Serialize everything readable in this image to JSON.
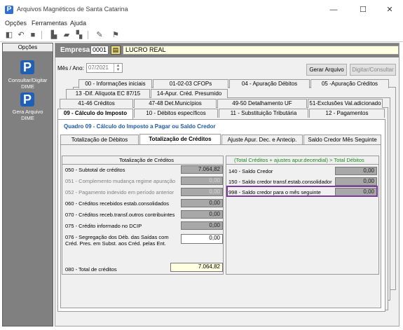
{
  "window": {
    "title": "Arquivos Magnéticos de Santa Catarina",
    "minimize": "—",
    "maximize": "☐",
    "close": "✕"
  },
  "menu": [
    "Opções",
    "Ferramentas",
    "Ajuda"
  ],
  "sidebar": {
    "header": "Opções",
    "items": [
      {
        "label_l1": "Consultar/Digitar",
        "label_l2": "DIME",
        "icon": "P"
      },
      {
        "label_l1": "Gera Arquivo",
        "label_l2": "DIME",
        "icon": "P"
      }
    ]
  },
  "empresa": {
    "label": "Empresa",
    "code": "0001",
    "name": "LUCRO REAL"
  },
  "periodo": {
    "label": "Mês / Ano:",
    "value": "07/2021"
  },
  "buttons": {
    "gerar": "Gerar Arquivo",
    "digitar": "Digitar/Consultar"
  },
  "tabs_row1": [
    "00 - Informações iniciais",
    "01-02-03   CFOPs",
    "04 - Apuração Débitos",
    "05 -Apuração Créditos"
  ],
  "tabs_row2": [
    "13 -Dif. Alíquota EC 87/15",
    "14-Apur. Créd. Presumido"
  ],
  "tabs_row3": [
    "41-46   Créditos",
    "47-48  Det.Municípios",
    "49-50  Detalhamento UF",
    "51-Exclusões Val.adicionado"
  ],
  "tabs_row4": [
    "09 - Cálculo do Imposto",
    "10 - Débitos específicos",
    "11 - Substituição Tributária",
    "12 - Pagamentos"
  ],
  "quadro_title": "Quadro 09 - Cálculo do Imposto a Pagar ou Saldo Credor",
  "subtabs": [
    "Totalização de Débitos",
    "Totalização de Créditos",
    "Ajuste Apur. Dec. e Antecip.",
    "Saldo Credor Mês Seguinte"
  ],
  "left": {
    "header": "Totalização de Créditos",
    "rows": [
      {
        "label": "050 - Subtotal de créditos",
        "value": "7.064,82"
      },
      {
        "label": "051 - Complemento mudança regime apuração",
        "value": "0,00"
      },
      {
        "label": "052 - Pagamento indevido em período anterior",
        "value": "0,00"
      },
      {
        "label": "060 - Créditos recebidos estab.consolidados",
        "value": "0,00"
      },
      {
        "label": "070 - Créditos receb.transf.outros contribuintes",
        "value": "0,00"
      },
      {
        "label": "075 - Crédito informado no DCIP",
        "value": "0,00"
      },
      {
        "label_l1": "076 - Segregação dos Déb. das Saídas com",
        "label_l2": "Créd. Pres. em Subst. aos Créd. pelas Ent.",
        "value": "0,00"
      }
    ],
    "total_label": "080 - Total de créditos",
    "total_value": "7.064,82"
  },
  "right": {
    "header": "(Total Créditos + ajustes apur.decendial) > Total Débitos",
    "rows": [
      {
        "label": "140 - Saldo Credor",
        "value": "0,00"
      },
      {
        "label": "150 - Saldo credor transf.estab.consolidador",
        "value": "0,00"
      },
      {
        "label": "998 - Saldo credor para o mês seguinte",
        "value": "0,00"
      }
    ]
  }
}
